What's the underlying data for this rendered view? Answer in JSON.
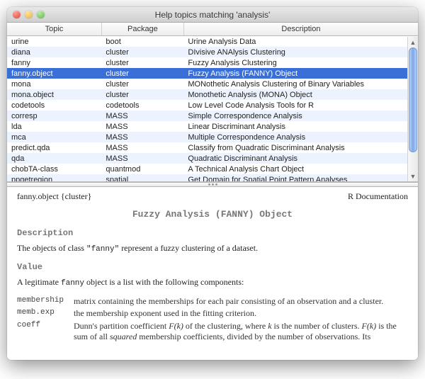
{
  "window": {
    "title": "Help topics matching 'analysis'"
  },
  "columns": {
    "topic": "Topic",
    "package": "Package",
    "description": "Description"
  },
  "rows": [
    {
      "topic": "urine",
      "package": "boot",
      "description": "Urine Analysis Data"
    },
    {
      "topic": "diana",
      "package": "cluster",
      "description": "DIvisive ANAlysis Clustering"
    },
    {
      "topic": "fanny",
      "package": "cluster",
      "description": "Fuzzy Analysis Clustering"
    },
    {
      "topic": "fanny.object",
      "package": "cluster",
      "description": "Fuzzy Analysis (FANNY) Object"
    },
    {
      "topic": "mona",
      "package": "cluster",
      "description": "MONothetic Analysis Clustering of Binary Variables"
    },
    {
      "topic": "mona.object",
      "package": "cluster",
      "description": "Monothetic Analysis (MONA) Object"
    },
    {
      "topic": "codetools",
      "package": "codetools",
      "description": "Low Level Code Analysis Tools for R"
    },
    {
      "topic": "corresp",
      "package": "MASS",
      "description": "Simple Correspondence Analysis"
    },
    {
      "topic": "lda",
      "package": "MASS",
      "description": "Linear Discriminant Analysis"
    },
    {
      "topic": "mca",
      "package": "MASS",
      "description": "Multiple Correspondence Analysis"
    },
    {
      "topic": "predict.qda",
      "package": "MASS",
      "description": "Classify from Quadratic Discriminant Analysis"
    },
    {
      "topic": "qda",
      "package": "MASS",
      "description": "Quadratic Discriminant Analysis"
    },
    {
      "topic": "chobTA-class",
      "package": "quantmod",
      "description": "A Technical Analysis Chart Object"
    },
    {
      "topic": "ppgetregion",
      "package": "spatial",
      "description": "Get Domain for Spatial Point Pattern Analyses"
    }
  ],
  "selectedIndex": 3,
  "doc": {
    "head_left": "fanny.object {cluster}",
    "head_right": "R Documentation",
    "title": "Fuzzy Analysis (FANNY) Object",
    "sec_description": "Description",
    "desc_pre": "The objects of class ",
    "desc_code": "\"fanny\"",
    "desc_post": " represent a fuzzy clustering of a dataset.",
    "sec_value": "Value",
    "value_pre": "A legitimate ",
    "value_code": "fanny",
    "value_post": " object is a list with the following components:",
    "components": [
      {
        "key": "membership",
        "val": "matrix containing the memberships for each pair consisting of an observation and a cluster."
      },
      {
        "key": "memb.exp",
        "val": "the membership exponent used in the fitting criterion."
      },
      {
        "key": "coeff",
        "val_pre": "Dunn's partition coefficient ",
        "val_ital1": "F(k)",
        "val_mid": " of the clustering, where ",
        "val_ital2": "k",
        "val_mid2": " is the number of clusters. ",
        "val_ital3": "F(k)",
        "val_post": " is the sum of all ",
        "val_ital4": "squared",
        "val_end": " membership coefficients, divided by the number of observations. Its"
      }
    ]
  }
}
